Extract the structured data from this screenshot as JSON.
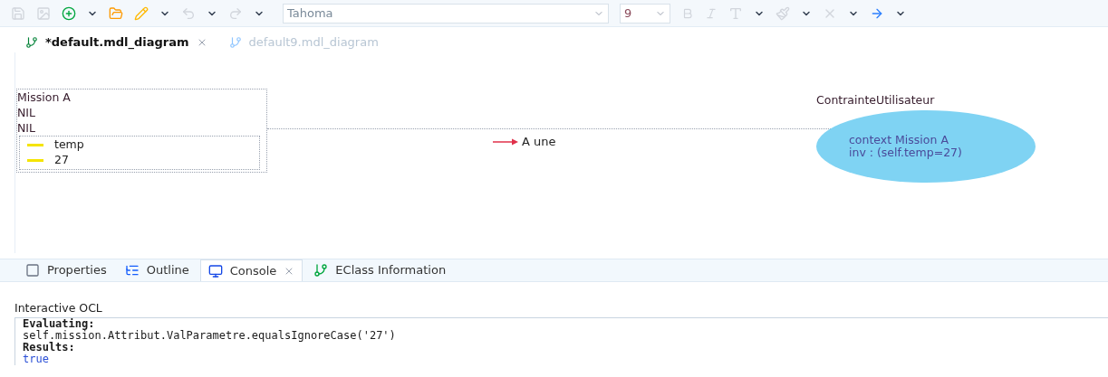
{
  "toolbar": {
    "font_name": "Tahoma",
    "font_size": "9"
  },
  "editor_tabs": [
    {
      "label": "*default.mdl_diagram",
      "selected": true
    },
    {
      "label": "default9.mdl_diagram",
      "selected": false
    }
  ],
  "diagram": {
    "class_node": {
      "name": "Mission A",
      "lines": [
        "NIL",
        "NIL"
      ],
      "attributes": [
        "temp",
        "27"
      ]
    },
    "association": {
      "label": "A une"
    },
    "constraint": {
      "name": "ContrainteUtilisateur",
      "body": [
        "context Mission A",
        "inv : (self.temp=27)"
      ]
    }
  },
  "view_tabs": [
    {
      "label": "Properties",
      "kind": "properties",
      "selected": false
    },
    {
      "label": "Outline",
      "kind": "outline",
      "selected": false
    },
    {
      "label": "Console",
      "kind": "console",
      "selected": true
    },
    {
      "label": "EClass Information",
      "kind": "eclass",
      "selected": false
    }
  ],
  "console": {
    "title": "Interactive OCL",
    "lines": [
      {
        "text": "Evaluating:",
        "kind": "label"
      },
      {
        "text": "self.mission.Attribut.ValParametre.equalsIgnoreCase('27')",
        "kind": "code"
      },
      {
        "text": "Results:",
        "kind": "label"
      },
      {
        "text": "true",
        "kind": "result"
      }
    ]
  }
}
